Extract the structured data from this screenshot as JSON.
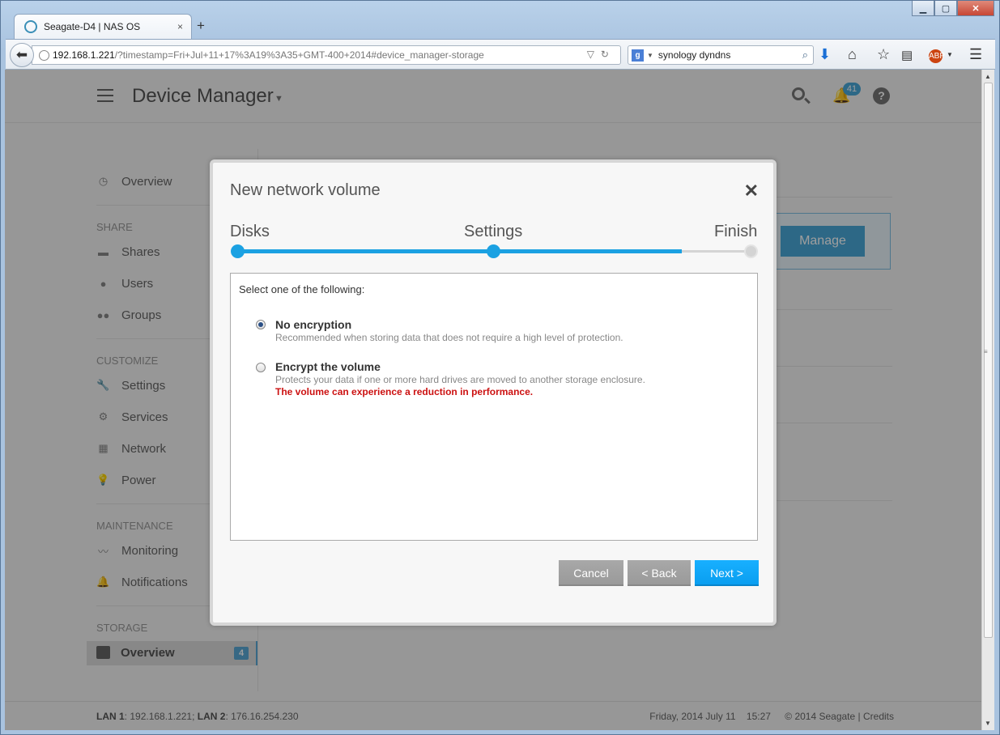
{
  "browser": {
    "tab_title": "Seagate-D4 | NAS OS",
    "tab_close": "×",
    "new_tab": "+",
    "url_host": "192.168.1.221",
    "url_path": "/?timestamp=Fri+Jul+11+17%3A19%3A35+GMT-400+2014#device_manager-storage",
    "search_text": "synology dyndns",
    "window_controls": {
      "minimize": "▁",
      "maximize": "▢",
      "close": "✕"
    }
  },
  "app": {
    "title": "Device Manager",
    "notifications_count": "41",
    "help": "?"
  },
  "sidebar": {
    "overview": "Overview",
    "share_header": "SHARE",
    "shares": "Shares",
    "users": "Users",
    "groups": "Groups",
    "customize_header": "CUSTOMIZE",
    "settings": "Settings",
    "services": "Services",
    "network": "Network",
    "power": "Power",
    "maintenance_header": "MAINTENANCE",
    "monitoring": "Monitoring",
    "notifications": "Notifications",
    "storage_header": "STORAGE",
    "storage_overview": "Overview",
    "storage_badge": "4"
  },
  "main": {
    "manage_button": "Manage"
  },
  "footer": {
    "lan1_label": "LAN 1",
    "lan1_value": ": 192.168.1.221;",
    "lan2_label": "LAN 2",
    "lan2_value": ": 176.16.254.230",
    "datetime": "Friday, 2014 July 11    15:27",
    "copyright": "© 2014 Seagate | Credits"
  },
  "modal": {
    "title": "New network volume",
    "close": "✕",
    "steps": [
      "Disks",
      "Settings",
      "Finish"
    ],
    "prompt": "Select one of the following:",
    "option1_title": "No encryption",
    "option1_desc": "Recommended when storing data that does not require a high level of protection.",
    "option2_title": "Encrypt the volume",
    "option2_desc": "Protects your data if one or more hard drives are moved to another storage enclosure.",
    "option2_warning": "The volume can experience a reduction in performance.",
    "selected_option": "No encryption",
    "cancel": "Cancel",
    "back": "< Back",
    "next": "Next >"
  },
  "colors": {
    "accent": "#1ba1e2",
    "warning": "#cc1111"
  }
}
